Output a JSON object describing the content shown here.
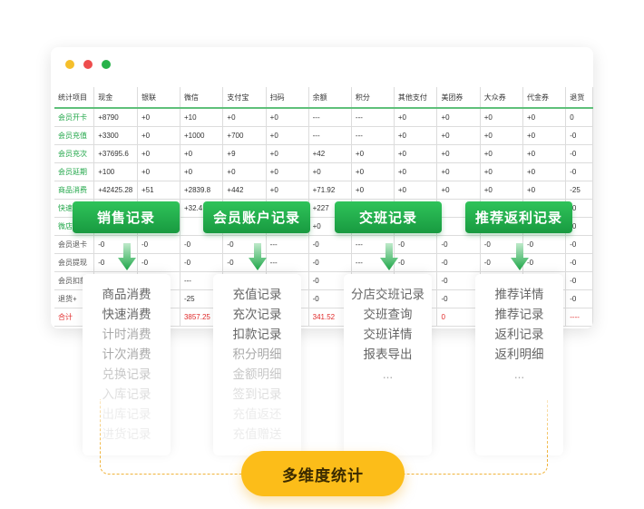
{
  "window": {
    "colors": {
      "dot_yellow": "#f5bf2b",
      "dot_red": "#ee4d4d",
      "dot_green": "#27b24a"
    }
  },
  "table": {
    "headers": [
      "统计项目",
      "现金",
      "银联",
      "微信",
      "支付宝",
      "扫码",
      "余额",
      "积分",
      "其他支付",
      "美团券",
      "大众券",
      "代金券",
      "退货"
    ],
    "rows": [
      [
        "会员开卡",
        "+8790",
        "+0",
        "+10",
        "+0",
        "+0",
        "---",
        "---",
        "+0",
        "+0",
        "+0",
        "+0",
        "0"
      ],
      [
        "会员充值",
        "+3300",
        "+0",
        "+1000",
        "+700",
        "+0",
        "---",
        "---",
        "+0",
        "+0",
        "+0",
        "+0",
        "-0"
      ],
      [
        "会员充次",
        "+37695.6",
        "+0",
        "+0",
        "+9",
        "+0",
        "+42",
        "+0",
        "+0",
        "+0",
        "+0",
        "+0",
        "-0"
      ],
      [
        "会员延期",
        "+100",
        "+0",
        "+0",
        "+0",
        "+0",
        "+0",
        "+0",
        "+0",
        "+0",
        "+0",
        "+0",
        "-0"
      ],
      [
        "商品消费",
        "+42425.28",
        "+51",
        "+2839.8",
        "+442",
        "+0",
        "+71.92",
        "+0",
        "+0",
        "+0",
        "+0",
        "+0",
        "-25"
      ],
      [
        "快速消费",
        "",
        "",
        "+32.4",
        "",
        "",
        "+227",
        "",
        "",
        "",
        "",
        "",
        "-0"
      ],
      [
        "微店",
        "",
        "",
        "",
        "",
        "",
        "+0",
        "",
        "",
        "",
        "",
        "",
        "-0"
      ],
      [
        "会员退卡",
        "-0",
        "-0",
        "-0",
        "-0",
        "---",
        "-0",
        "---",
        "-0",
        "-0",
        "-0",
        "-0",
        "-0"
      ],
      [
        "会员提现",
        "-0",
        "-0",
        "-0",
        "-0",
        "---",
        "-0",
        "---",
        "-0",
        "-0",
        "-0",
        "-0",
        "-0"
      ],
      [
        "会员扣款",
        "",
        "",
        "---",
        "",
        "",
        "-0",
        "",
        "",
        "-0",
        "",
        "",
        "-0"
      ],
      [
        "退货+",
        "",
        "",
        "-25",
        "",
        "",
        "-0",
        "",
        "",
        "-0",
        "",
        "",
        "-0"
      ],
      [
        "合计",
        "",
        "",
        "3857.25",
        "",
        "",
        "341.52",
        "",
        "",
        "0",
        "",
        "",
        "----"
      ]
    ]
  },
  "categories": [
    {
      "label": "销售记录",
      "items": [
        "商品消费",
        "快速消费",
        "计时消费",
        "计次消费",
        "兑换记录",
        "入库记录",
        "出库记录",
        "进货记录"
      ]
    },
    {
      "label": "会员账户记录",
      "items": [
        "充值记录",
        "充次记录",
        "扣款记录",
        "积分明细",
        "金额明细",
        "签到记录",
        "充值返还",
        "充值赠送"
      ]
    },
    {
      "label": "交班记录",
      "items": [
        "分店交班记录",
        "交班查询",
        "交班详情",
        "报表导出",
        "..."
      ]
    },
    {
      "label": "推荐返利记录",
      "items": [
        "推荐详情",
        "推荐记录",
        "返利记录",
        "返利明细",
        "..."
      ]
    }
  ],
  "badge": {
    "label": "多维度统计",
    "color": "#fcbd19"
  },
  "accent_green": "#1fa94a"
}
